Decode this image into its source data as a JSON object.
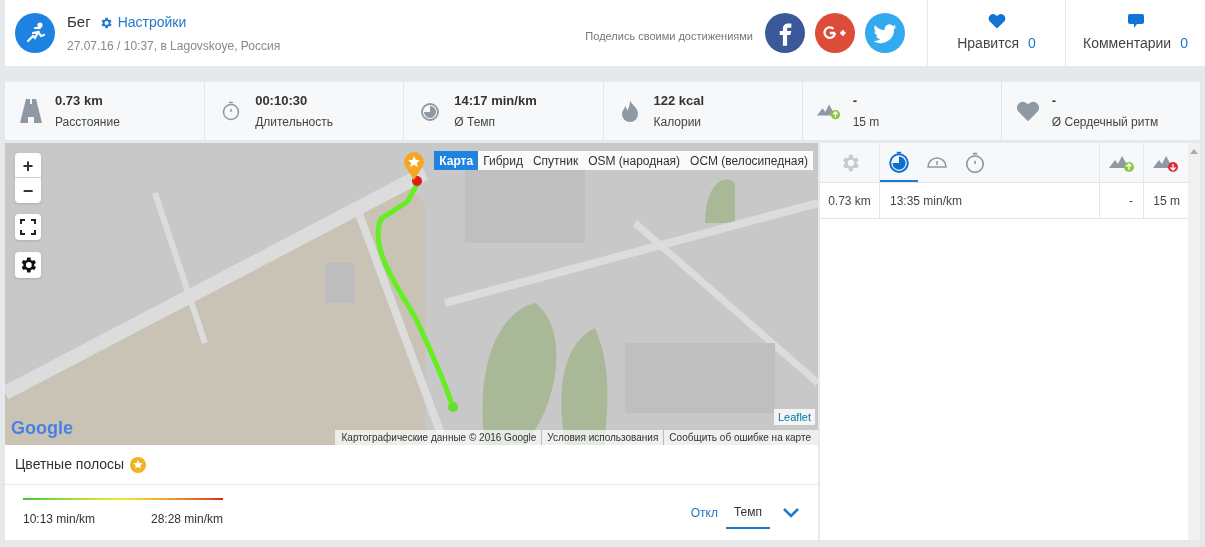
{
  "activity": {
    "title": "Бег",
    "settings_link": "Настройки",
    "subtitle": "27.07.16 / 10:37, в Lagovskoye, Россия"
  },
  "share": {
    "label": "Поделись своими достижениями",
    "networks": [
      {
        "kind": "facebook",
        "color": "#3b5998"
      },
      {
        "kind": "googleplus",
        "color": "#dd4b39"
      },
      {
        "kind": "twitter",
        "color": "#33aaf0"
      }
    ]
  },
  "social": [
    {
      "kind": "like",
      "label": "Нравится",
      "count": "0"
    },
    {
      "kind": "comments",
      "label": "Комментарии",
      "count": "0"
    }
  ],
  "stats": [
    {
      "kind": "road",
      "value": "0.73 km",
      "label": "Расстояние"
    },
    {
      "kind": "stopwatch",
      "value": "00:10:30",
      "label": "Длительность"
    },
    {
      "kind": "pace",
      "value": "14:17 min/km",
      "label": "Ø Темп"
    },
    {
      "kind": "flame",
      "value": "122 kcal",
      "label": "Калории"
    },
    {
      "kind": "ascent",
      "value": "-",
      "label": "15 m"
    },
    {
      "kind": "heart",
      "value": "-",
      "label": "Ø Сердечный ритм"
    }
  ],
  "map": {
    "layers": [
      {
        "label": "Карта",
        "selected": true
      },
      {
        "label": "Гибрид",
        "selected": false
      },
      {
        "label": "Спутник",
        "selected": false
      },
      {
        "label": "OSM (народная)",
        "selected": false
      },
      {
        "label": "ОСМ (велосипедная)",
        "selected": false
      }
    ],
    "zoom_in": "+",
    "zoom_out": "−",
    "logo": "Google",
    "leaflet": "Leaflet",
    "attribution": [
      "Картографические данные © 2016 Google",
      "Условия использования",
      "Сообщить об ошибке на карте"
    ]
  },
  "color_bands": {
    "title": "Цветные полосы",
    "min": "10:13 min/km",
    "max": "28:28 min/km",
    "options": [
      {
        "label": "Откл",
        "selected": false
      },
      {
        "label": "Темп",
        "selected": true
      }
    ]
  },
  "splits": {
    "tabs": [
      {
        "kind": "gear",
        "selected": false
      },
      {
        "kind": "pace",
        "selected": true
      },
      {
        "kind": "speed",
        "selected": false
      },
      {
        "kind": "stopwatch",
        "selected": false
      }
    ],
    "rows": [
      {
        "distance": "0.73 km",
        "pace": "13:35 min/km",
        "ascent": "-",
        "descent": "15 m"
      }
    ]
  }
}
